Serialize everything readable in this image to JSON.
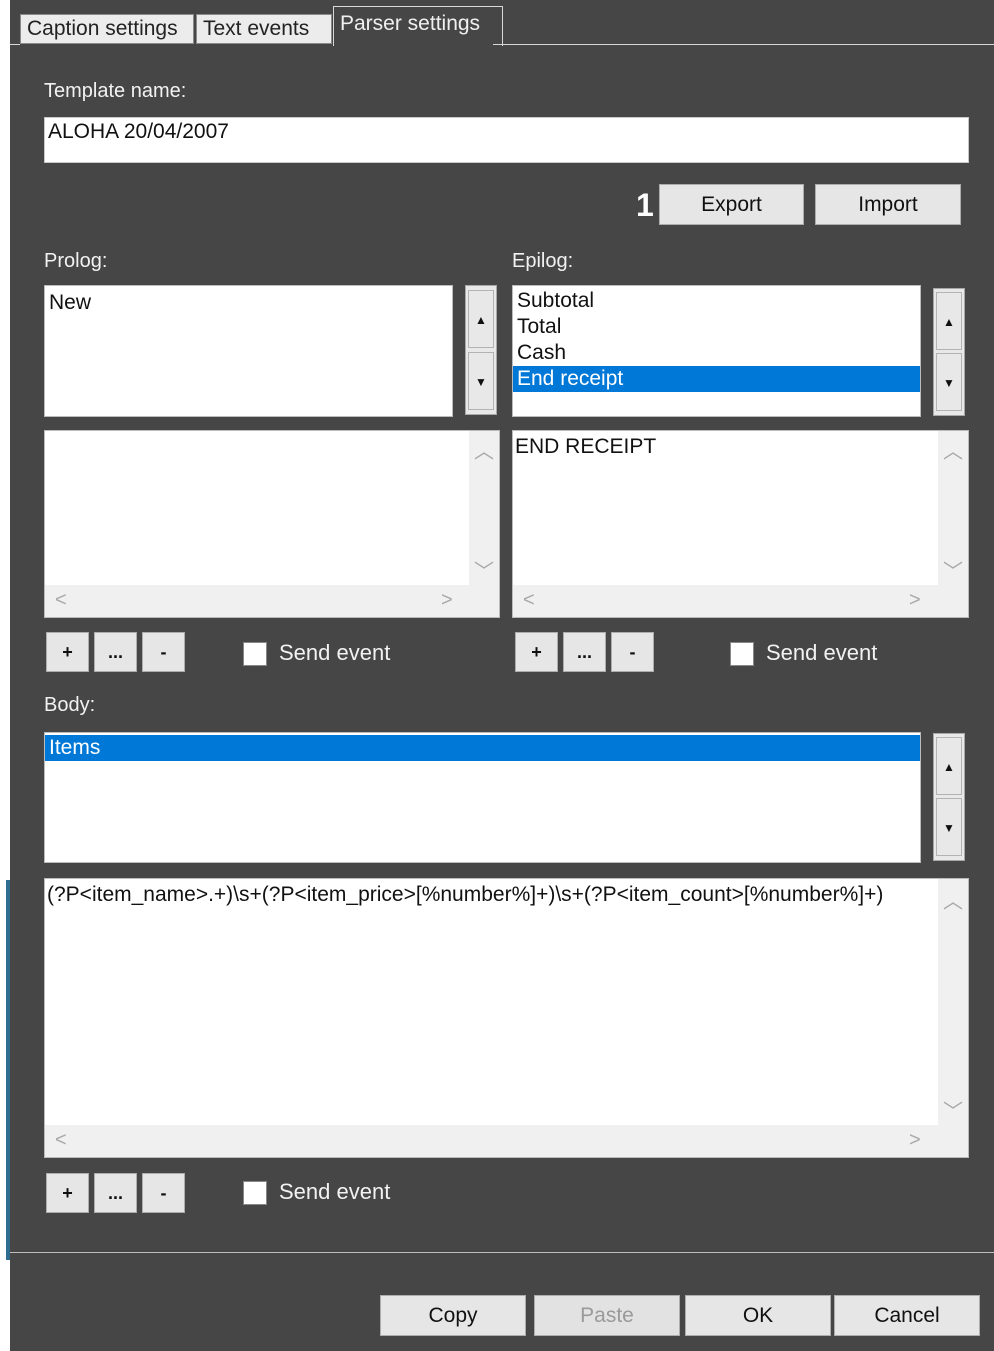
{
  "header_fragment": {
    "bold": "",
    "normal": ""
  },
  "tabs": [
    {
      "label": "Caption settings",
      "active": false
    },
    {
      "label": "Text events",
      "active": false
    },
    {
      "label": "Parser settings",
      "active": true
    }
  ],
  "template": {
    "label": "Template name:",
    "value": "ALOHA 20/04/2007"
  },
  "marker": "1",
  "buttons": {
    "export": "Export",
    "import": "Import",
    "add": "+",
    "edit": "...",
    "remove": "-"
  },
  "prolog": {
    "label": "Prolog:",
    "items": [
      {
        "text": "New",
        "selected": false
      }
    ],
    "editor_text": "",
    "send_event": "Send event"
  },
  "epilog": {
    "label": "Epilog:",
    "items": [
      {
        "text": "Subtotal",
        "selected": false
      },
      {
        "text": "Total",
        "selected": false
      },
      {
        "text": "Cash",
        "selected": false
      },
      {
        "text": "End receipt",
        "selected": true
      }
    ],
    "editor_text": "END RECEIPT",
    "send_event": "Send event"
  },
  "body": {
    "label": "Body:",
    "items": [
      {
        "text": "Items",
        "selected": true
      }
    ],
    "editor_text": "(?P<item_name>.+)\\s+(?P<item_price>[%number%]+)\\s+(?P<item_count>[%number%]+)",
    "send_event": "Send event"
  },
  "footer": {
    "copy": "Copy",
    "paste": "Paste",
    "ok": "OK",
    "cancel": "Cancel"
  },
  "icons": {
    "spin_up": "triangle-up-icon",
    "spin_down": "triangle-down-icon",
    "scroll_up": "chevron-up-icon",
    "scroll_down": "chevron-down-icon",
    "scroll_left": "chevron-left-icon",
    "scroll_right": "chevron-right-icon"
  },
  "colors": {
    "panel": "#464646",
    "selection": "#0078d7"
  }
}
